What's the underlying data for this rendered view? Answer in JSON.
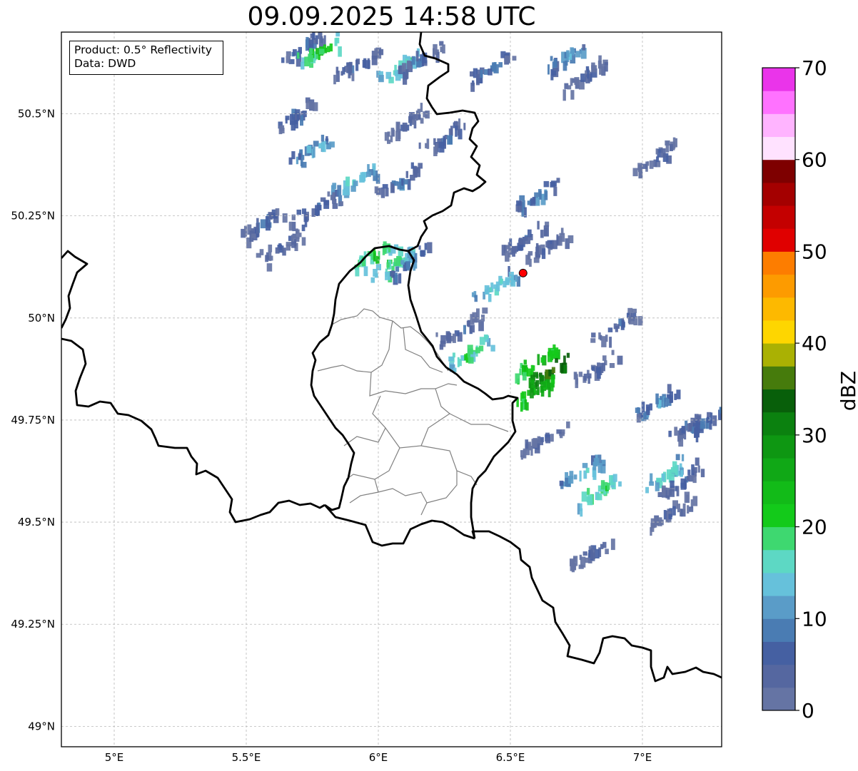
{
  "title": "09.09.2025 14:58 UTC",
  "info": {
    "product_line": "Product: 0.5° Reflectivity",
    "data_line": "Data: DWD"
  },
  "map": {
    "lon_range": [
      4.8,
      7.3
    ],
    "lat_range": [
      48.95,
      50.7
    ],
    "lon_ticks": [
      {
        "value": 5.0,
        "label": "5°E"
      },
      {
        "value": 5.5,
        "label": "5.5°E"
      },
      {
        "value": 6.0,
        "label": "6°E"
      },
      {
        "value": 6.5,
        "label": "6.5°E"
      },
      {
        "value": 7.0,
        "label": "7°E"
      }
    ],
    "lat_ticks": [
      {
        "value": 49.0,
        "label": "49°N"
      },
      {
        "value": 49.25,
        "label": "49.25°N"
      },
      {
        "value": 49.5,
        "label": "49.5°N"
      },
      {
        "value": 49.75,
        "label": "49.75°N"
      },
      {
        "value": 50.0,
        "label": "50°N"
      },
      {
        "value": 50.25,
        "label": "50.25°N"
      },
      {
        "value": 50.5,
        "label": "50.5°N"
      }
    ],
    "grid": true,
    "radar_site": {
      "lon": 6.548,
      "lat": 50.11,
      "color": "#ff0000"
    },
    "echoes": [
      {
        "lon": 5.72,
        "lat": 50.67,
        "dbz": 12
      },
      {
        "lon": 5.78,
        "lat": 50.66,
        "dbz": 24
      },
      {
        "lon": 5.92,
        "lat": 50.63,
        "dbz": 10
      },
      {
        "lon": 6.08,
        "lat": 50.62,
        "dbz": 20
      },
      {
        "lon": 6.15,
        "lat": 50.64,
        "dbz": 10
      },
      {
        "lon": 6.42,
        "lat": 50.62,
        "dbz": 12
      },
      {
        "lon": 6.72,
        "lat": 50.65,
        "dbz": 14
      },
      {
        "lon": 6.78,
        "lat": 50.6,
        "dbz": 8
      },
      {
        "lon": 5.68,
        "lat": 50.5,
        "dbz": 10
      },
      {
        "lon": 5.75,
        "lat": 50.42,
        "dbz": 16
      },
      {
        "lon": 5.9,
        "lat": 50.34,
        "dbz": 18
      },
      {
        "lon": 6.08,
        "lat": 50.34,
        "dbz": 12
      },
      {
        "lon": 6.25,
        "lat": 50.45,
        "dbz": 10
      },
      {
        "lon": 6.1,
        "lat": 50.48,
        "dbz": 8
      },
      {
        "lon": 5.56,
        "lat": 50.24,
        "dbz": 10
      },
      {
        "lon": 5.63,
        "lat": 50.18,
        "dbz": 8
      },
      {
        "lon": 5.75,
        "lat": 50.27,
        "dbz": 10
      },
      {
        "lon": 5.98,
        "lat": 50.16,
        "dbz": 24
      },
      {
        "lon": 6.05,
        "lat": 50.14,
        "dbz": 22
      },
      {
        "lon": 6.12,
        "lat": 50.15,
        "dbz": 14
      },
      {
        "lon": 6.6,
        "lat": 50.31,
        "dbz": 14
      },
      {
        "lon": 6.55,
        "lat": 50.2,
        "dbz": 10
      },
      {
        "lon": 6.63,
        "lat": 50.18,
        "dbz": 8
      },
      {
        "lon": 6.44,
        "lat": 50.08,
        "dbz": 18
      },
      {
        "lon": 6.31,
        "lat": 49.98,
        "dbz": 10
      },
      {
        "lon": 6.34,
        "lat": 49.92,
        "dbz": 22
      },
      {
        "lon": 6.6,
        "lat": 49.9,
        "dbz": 28
      },
      {
        "lon": 6.65,
        "lat": 49.88,
        "dbz": 38
      },
      {
        "lon": 6.6,
        "lat": 49.83,
        "dbz": 30
      },
      {
        "lon": 6.9,
        "lat": 49.99,
        "dbz": 10
      },
      {
        "lon": 6.82,
        "lat": 49.88,
        "dbz": 8
      },
      {
        "lon": 7.05,
        "lat": 50.4,
        "dbz": 8
      },
      {
        "lon": 7.05,
        "lat": 49.8,
        "dbz": 14
      },
      {
        "lon": 7.18,
        "lat": 49.74,
        "dbz": 10
      },
      {
        "lon": 7.25,
        "lat": 49.76,
        "dbz": 12
      },
      {
        "lon": 6.76,
        "lat": 49.63,
        "dbz": 18
      },
      {
        "lon": 6.83,
        "lat": 49.58,
        "dbz": 22
      },
      {
        "lon": 7.08,
        "lat": 49.62,
        "dbz": 20
      },
      {
        "lon": 7.15,
        "lat": 49.61,
        "dbz": 10
      },
      {
        "lon": 7.1,
        "lat": 49.53,
        "dbz": 8
      },
      {
        "lon": 6.62,
        "lat": 49.71,
        "dbz": 8
      },
      {
        "lon": 6.8,
        "lat": 49.43,
        "dbz": 8
      }
    ]
  },
  "colorbar": {
    "label": "dBZ",
    "range": [
      0,
      70
    ],
    "tick_labels": [
      "0",
      "10",
      "20",
      "30",
      "40",
      "50",
      "60",
      "70"
    ],
    "colors": [
      "#6574a4",
      "#5567a0",
      "#4560a2",
      "#4a7cb3",
      "#5a9cc8",
      "#66c1db",
      "#5dd8c4",
      "#3ed870",
      "#13ca1a",
      "#12bb18",
      "#10a816",
      "#0e9712",
      "#0b810f",
      "#085f0a",
      "#467b0c",
      "#aab103",
      "#fed600",
      "#fdb900",
      "#fd9b00",
      "#fd7d00",
      "#e00000",
      "#c40000",
      "#a40000",
      "#7e0000",
      "#ffe2ff",
      "#ffb4ff",
      "#ff72ff",
      "#ea34ea"
    ]
  }
}
